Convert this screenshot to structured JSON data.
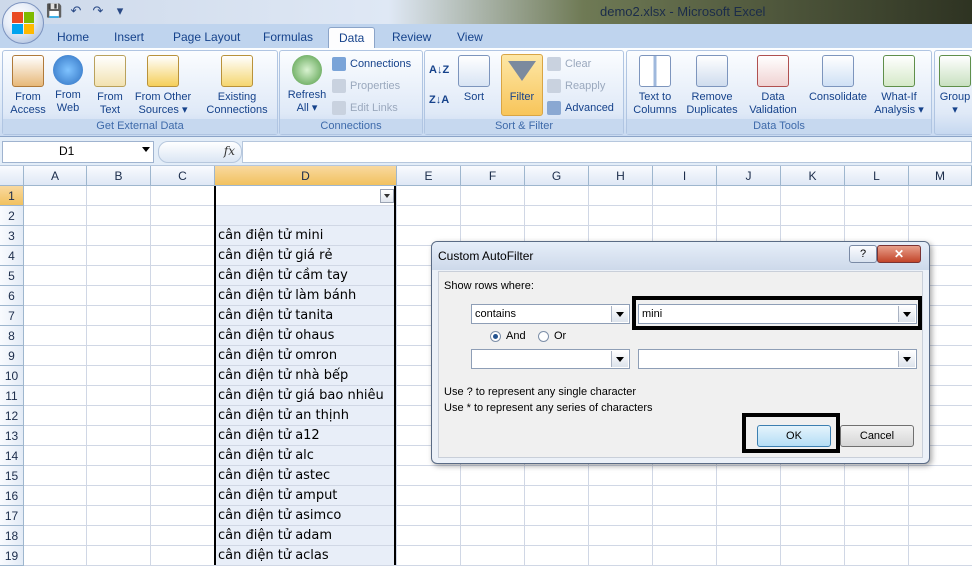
{
  "window": {
    "title": "demo2.xlsx - Microsoft Excel"
  },
  "ribbon_tabs": [
    "Home",
    "Insert",
    "Page Layout",
    "Formulas",
    "Data",
    "Review",
    "View"
  ],
  "active_tab": "Data",
  "groups": {
    "external_data": {
      "label": "Get External Data",
      "from_access": [
        "From",
        "Access"
      ],
      "from_web": [
        "From",
        "Web"
      ],
      "from_text": [
        "From",
        "Text"
      ],
      "from_other": [
        "From Other",
        "Sources ▾"
      ],
      "existing": [
        "Existing",
        "Connections"
      ]
    },
    "connections": {
      "label": "Connections",
      "refresh": [
        "Refresh",
        "All ▾"
      ],
      "connections": "Connections",
      "properties": "Properties",
      "edit_links": "Edit Links"
    },
    "sort_filter": {
      "label": "Sort & Filter",
      "sort": "Sort",
      "filter": "Filter",
      "clear": "Clear",
      "reapply": "Reapply",
      "advanced": "Advanced"
    },
    "data_tools": {
      "label": "Data Tools",
      "text_to_columns": [
        "Text to",
        "Columns"
      ],
      "remove_duplicates": [
        "Remove",
        "Duplicates"
      ],
      "data_validation": [
        "Data",
        "Validation ▾"
      ],
      "consolidate": "Consolidate",
      "what_if": [
        "What-If",
        "Analysis ▾"
      ]
    },
    "outline": {
      "group": [
        "Group",
        "▾"
      ]
    }
  },
  "formula_bar": {
    "name_box": "D1",
    "fx": "fx",
    "formula": ""
  },
  "columns": [
    "A",
    "B",
    "C",
    "D",
    "E",
    "F",
    "G",
    "H",
    "I",
    "J",
    "K",
    "L",
    "M"
  ],
  "rows": [
    "1",
    "2",
    "3",
    "4",
    "5",
    "6",
    "7",
    "8",
    "9",
    "10",
    "11",
    "12",
    "13",
    "14",
    "15",
    "16",
    "17",
    "18",
    "19"
  ],
  "column_d_values": [
    "",
    "",
    "cân điện tử mini",
    "cân điện tử giá rẻ",
    "cân điện tử cầm tay",
    "cân điện tử làm bánh",
    "cân điện tử tanita",
    "cân điện tử ohaus",
    "cân điện tử omron",
    "cân điện tử nhà bếp",
    "cân điện tử giá bao nhiêu",
    "cân điện tử an thịnh",
    "cân điện tử a12",
    "cân điện tử alc",
    "cân điện tử astec",
    "cân điện tử amput",
    "cân điện tử asimco",
    "cân điện tử adam",
    "cân điện tử aclas"
  ],
  "dialog": {
    "title": "Custom AutoFilter",
    "help": "?",
    "close": "✕",
    "show_rows_where": "Show rows where:",
    "operator1": "contains",
    "value1": "mini",
    "and_label": "And",
    "or_label": "Or",
    "and_selected": true,
    "operator2": "",
    "value2": "",
    "hint1": "Use ? to represent any single character",
    "hint2": "Use * to represent any series of characters",
    "ok": "OK",
    "cancel": "Cancel"
  },
  "icons": {
    "office_button": "office-logo",
    "save": "save-icon",
    "undo": "undo-icon",
    "redo": "redo-icon",
    "sort_az": "sort-az-icon",
    "sort_za": "sort-za-icon",
    "filter": "funnel-icon"
  }
}
